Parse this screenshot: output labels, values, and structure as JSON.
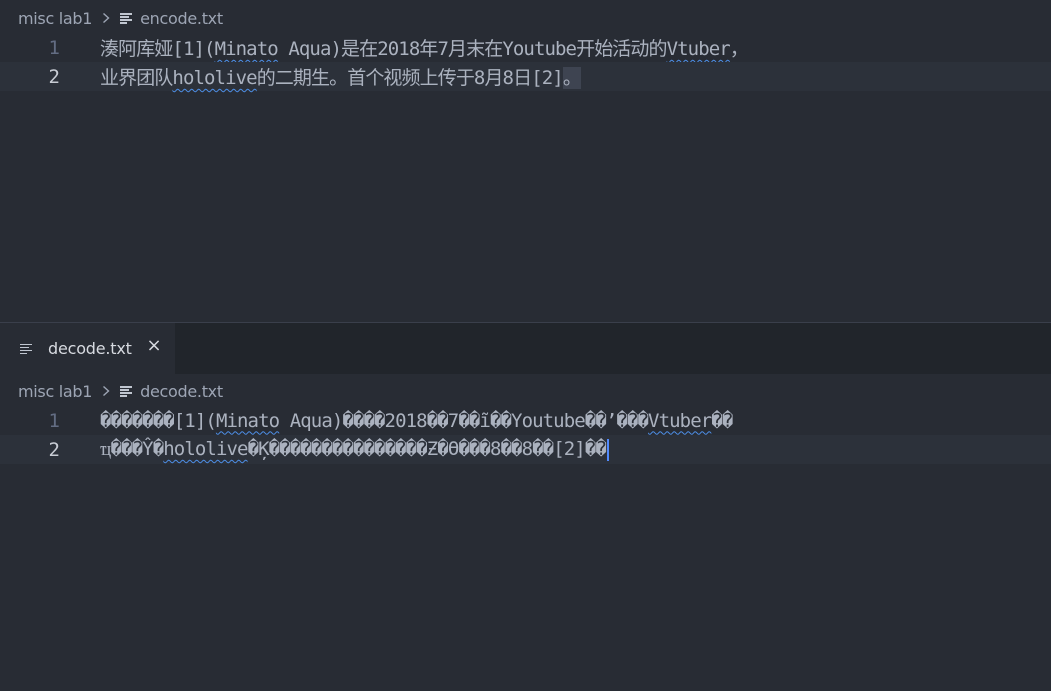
{
  "top_pane": {
    "breadcrumb": {
      "folder": "misc lab1",
      "file": "encode.txt"
    },
    "lines": [
      {
        "number": "1",
        "segments": [
          "湊阿库娅[1](",
          "Minato",
          " Aqua)是在2018年7月末在Youtube开始活动的",
          "Vtuber",
          "，"
        ]
      },
      {
        "number": "2",
        "segments": [
          "业界团队",
          "hololive",
          "的二期生。首个视频上传于8月8日[2]",
          "。"
        ]
      }
    ]
  },
  "bottom_pane": {
    "tab": {
      "label": "decode.txt",
      "close": "×"
    },
    "breadcrumb": {
      "folder": "misc lab1",
      "file": "decode.txt"
    },
    "lines": [
      {
        "number": "1",
        "segments": [
          "�������[1](",
          "Minato",
          " Aqua)����2018��7��ĩ��Youtube��’���",
          "Vtuber",
          "��"
        ]
      },
      {
        "number": "2",
        "segments": [
          "ҵ���Ŷ�",
          "hololive",
          "�Ķ������������׸���Ƶ�ϴ���8��8��[2]��"
        ]
      }
    ]
  },
  "icons": {
    "chevron": "chevron-right-icon",
    "file": "lines-file-icon",
    "close": "close-icon"
  },
  "colors": {
    "editor_bg": "#282c34",
    "tabbar_bg": "#21252b",
    "current_line": "#2c313a",
    "squiggle": "#4d8fe8",
    "cursor": "#528bff"
  }
}
